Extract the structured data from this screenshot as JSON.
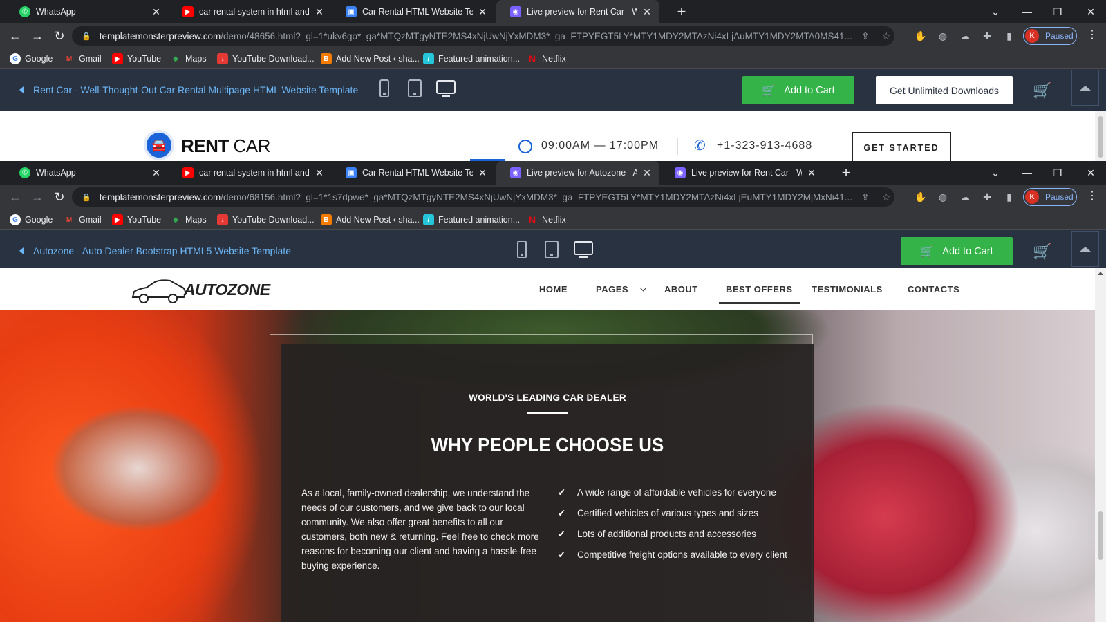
{
  "windows": [
    {
      "tabs": [
        {
          "title": "WhatsApp",
          "icon": "whatsapp-icon",
          "color": "#25d366"
        },
        {
          "title": "car rental system in html and css",
          "icon": "youtube-icon",
          "color": "#ff0000"
        },
        {
          "title": "Car Rental HTML Website Templa",
          "icon": "template-icon",
          "color": "#3b82f6"
        },
        {
          "title": "Live preview for Rent Car - Well-T",
          "icon": "preview-icon",
          "color": "#7b61ff",
          "active": true
        }
      ],
      "url_host": "templatemonsterpreview.com",
      "url_rest": "/demo/48656.html?_gl=1*ukv6go*_ga*MTQzMTgyNTE2MS4xNjUwNjYxMDM3*_ga_FTPYEGT5LY*MTY1MDY2MTAzNi4xLjAuMTY1MDY2MTA0MS41...",
      "tm_title": "Rent Car - Well-Thought-Out Car Rental Multipage HTML Website Template",
      "add_to_cart": "Add to Cart",
      "unlimited": "Get Unlimited Downloads",
      "site": {
        "brand_bold": "RENT",
        "brand_light": " CAR",
        "hours": "09:00AM — 17:00PM",
        "phone": "+1-323-913-4688",
        "cta": "GET STARTED"
      }
    },
    {
      "tabs": [
        {
          "title": "WhatsApp",
          "icon": "whatsapp-icon",
          "color": "#25d366"
        },
        {
          "title": "car rental system in html and css",
          "icon": "youtube-icon",
          "color": "#ff0000"
        },
        {
          "title": "Car Rental HTML Website Templa",
          "icon": "template-icon",
          "color": "#3b82f6"
        },
        {
          "title": "Live preview for Autozone - Auto",
          "icon": "preview-icon",
          "color": "#7b61ff",
          "active": true
        },
        {
          "title": "Live preview for Rent Car - Well-T",
          "icon": "preview-icon",
          "color": "#7b61ff"
        }
      ],
      "url_host": "templatemonsterpreview.com",
      "url_rest": "/demo/68156.html?_gl=1*1s7dpwe*_ga*MTQzMTgyNTE2MS4xNjUwNjYxMDM3*_ga_FTPYEGT5LY*MTY1MDY2MTAzNi4xLjEuMTY1MDY2MjMxNi41...",
      "tm_title": "Autozone - Auto Dealer Bootstrap HTML5 Website Template",
      "add_to_cart": "Add to Cart",
      "site": {
        "brand": "AUTOZONE",
        "menu": [
          "HOME",
          "PAGES",
          "ABOUT",
          "BEST OFFERS",
          "TESTIMONIALS",
          "CONTACTS"
        ],
        "active_menu": "BEST OFFERS",
        "eyebrow": "WORLD'S LEADING CAR DEALER",
        "headline": "WHY PEOPLE CHOOSE US",
        "paragraph": "As a local, family-owned dealership, we understand the needs of our customers, and we give back to our local community. We also offer great benefits to all our customers, both new & returning. Feel free to check more reasons for becoming our client and having a hassle-free buying experience.",
        "checks": [
          "A wide range of affordable vehicles for everyone",
          "Certified vehicles of various types and sizes",
          "Lots of additional products and accessories",
          "Competitive freight options available to every client"
        ]
      }
    }
  ],
  "bookmarks": [
    {
      "label": "Google",
      "icon": "google-icon"
    },
    {
      "label": "Gmail",
      "icon": "gmail-icon"
    },
    {
      "label": "YouTube",
      "icon": "youtube-icon"
    },
    {
      "label": "Maps",
      "icon": "maps-icon"
    },
    {
      "label": "YouTube Download...",
      "icon": "download-icon"
    },
    {
      "label": "Add New Post ‹ sha...",
      "icon": "blogger-icon"
    },
    {
      "label": "Featured animation...",
      "icon": "animation-icon"
    },
    {
      "label": "Netflix",
      "icon": "netflix-icon"
    }
  ],
  "profile": {
    "initial": "K",
    "status": "Paused"
  },
  "colors": {
    "tm_bar": "#293241",
    "cart_green": "#34b349",
    "link_blue": "#6cb5f5",
    "rentcar_blue": "#1a63d8"
  }
}
